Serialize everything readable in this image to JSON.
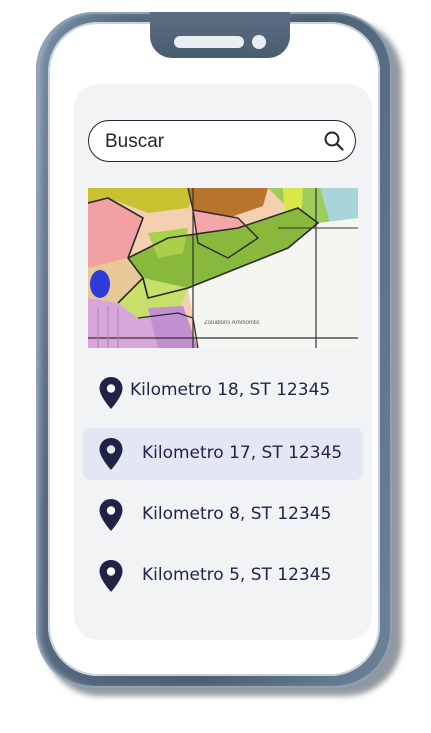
{
  "search": {
    "placeholder": "Buscar",
    "icon": "search-icon"
  },
  "map": {
    "caption": "Zonations Ammonitic"
  },
  "locations": [
    {
      "label": "Kilometro 18, ST 12345",
      "icon": "location-pin-icon",
      "selected": false
    },
    {
      "label": "Kilometro 17, ST 12345",
      "icon": "location-pin-icon",
      "selected": true
    },
    {
      "label": "Kilometro 8, ST 12345",
      "icon": "location-pin-icon",
      "selected": false
    },
    {
      "label": "Kilometro 5, ST 12345",
      "icon": "location-pin-icon",
      "selected": false
    }
  ],
  "colors": {
    "accent": "#1f2347",
    "selected_row": "#e3e7f4",
    "phone_frame": "#566a80"
  }
}
